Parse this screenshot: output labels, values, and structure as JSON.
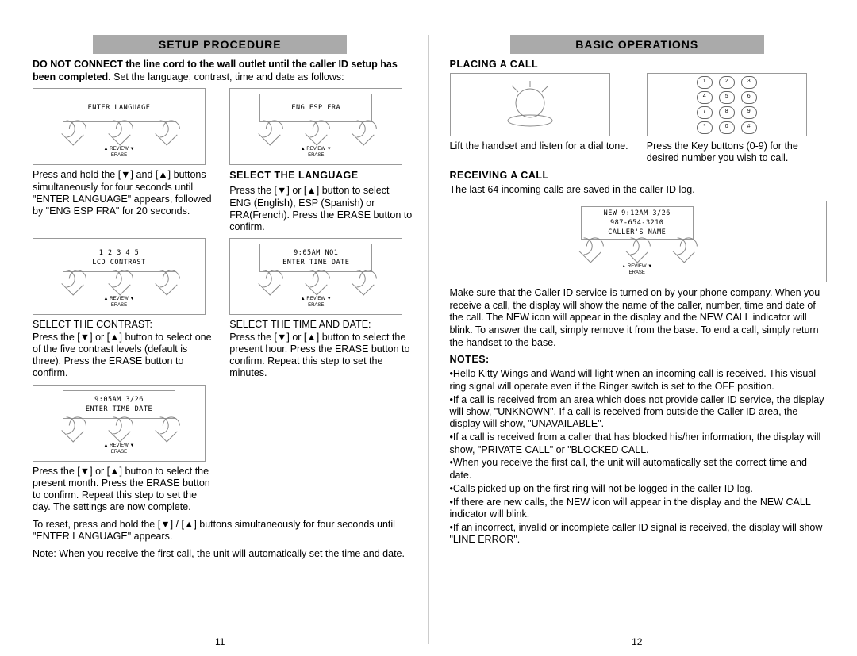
{
  "left": {
    "header": "SETUP  PROCEDURE",
    "intro_bold": "DO NOT CONNECT the line cord to the wall outlet until the caller ID setup has been completed.",
    "intro_rest": " Set the language, contrast, time and date as follows:",
    "step1": {
      "lcd1": "ENTER LANGUAGE",
      "lcd2": "",
      "caption": "Press and hold the [▼] and [▲] buttons simultaneously for four seconds until \"ENTER  LANGUAGE\" appears, followed by \"ENG ESP FRA\" for 20 seconds."
    },
    "step2": {
      "lcd1": "ENG  ESP  FRA",
      "lcd2": "",
      "subhead": "SELECT THE LANGUAGE",
      "caption": "Press the [▼] or [▲] button to select ENG (English), ESP (Spanish) or FRA(French). Press the ERASE button to confirm."
    },
    "step3": {
      "lcd1": "1 2 3 4 5",
      "lcd2": "LCD  CONTRAST",
      "subhead": "SELECT THE CONTRAST:",
      "caption": "Press the [▼] or [▲] button to select one of the five contrast levels (default is three). Press the ERASE button to confirm."
    },
    "step4": {
      "lcd1": "9:05AM  NO1",
      "lcd2": "ENTER TIME DATE",
      "subhead": "SELECT THE TIME AND DATE:",
      "caption": "Press the [▼] or [▲] button to select the present hour. Press the ERASE button to confirm. Repeat this step to set the minutes."
    },
    "step5": {
      "lcd1": "9:05AM  3/26",
      "lcd2": "ENTER TIME DATE",
      "caption": "Press the [▼] or [▲] button to select the present month. Press the ERASE button to confirm. Repeat this step to set the day. The settings are now complete."
    },
    "reset": "To reset, press and hold the [▼] / [▲] buttons simultaneously for four seconds until \"ENTER LANGUAGE\" appears.",
    "reset_note": "Note: When you receive the first call, the unit will automatically set the time and date.",
    "pagenum": "11"
  },
  "right": {
    "header": "BASIC OPERATIONS",
    "placing_head": "PLACING A CALL",
    "placing_left_cap": "Lift the handset and listen for a dial tone.",
    "placing_right_cap": "Press the Key buttons (0-9) for the desired number you wish to call.",
    "receiving_head": "RECEIVING A CALL",
    "receiving_intro": "The last 64 incoming calls are saved in the caller ID log.",
    "receiving_lcd1": "NEW 9:12AM 3/26",
    "receiving_lcd2": "987-654-3210",
    "receiving_lcd3": "CALLER'S NAME",
    "receiving_para": "Make sure that the Caller ID service is turned on by your phone company. When you receive a call, the display will show the name of the caller, number, time and date of the call. The NEW icon will appear in the display and the NEW CALL indicator will blink. To answer the call, simply remove it from the base. To end a call, simply return the handset to the base.",
    "notes_head": "NOTES:",
    "notes": [
      "Hello Kitty Wings and Wand will light when an incoming call is received. This visual ring signal will operate even if the Ringer switch is set to the OFF position.",
      "If a call is received from an area which does not provide caller ID service, the display will show,  \"UNKNOWN\". If a call is received from outside the Caller ID area, the display will show, \"UNAVAILABLE\".",
      "If a call is received from a caller that has blocked his/her information, the display will show, \"PRIVATE CALL\" or \"BLOCKED CALL.",
      "When you receive the first call, the unit will automatically set the correct time and date.",
      "Calls picked up on the first ring will not be logged in the caller ID log.",
      "If there are new calls, the NEW icon will appear in the display and the NEW CALL indicator will blink.",
      "If an incorrect, invalid or incomplete caller ID signal is received, the display will show \"LINE ERROR\"."
    ],
    "pagenum": "12"
  },
  "labels": {
    "review": "▲ REVIEW ▼",
    "erase": "ERASE"
  },
  "keypad": [
    [
      "1",
      "2",
      "3"
    ],
    [
      "4",
      "5",
      "6"
    ],
    [
      "7",
      "8",
      "9"
    ],
    [
      "*",
      "0",
      "#"
    ]
  ]
}
